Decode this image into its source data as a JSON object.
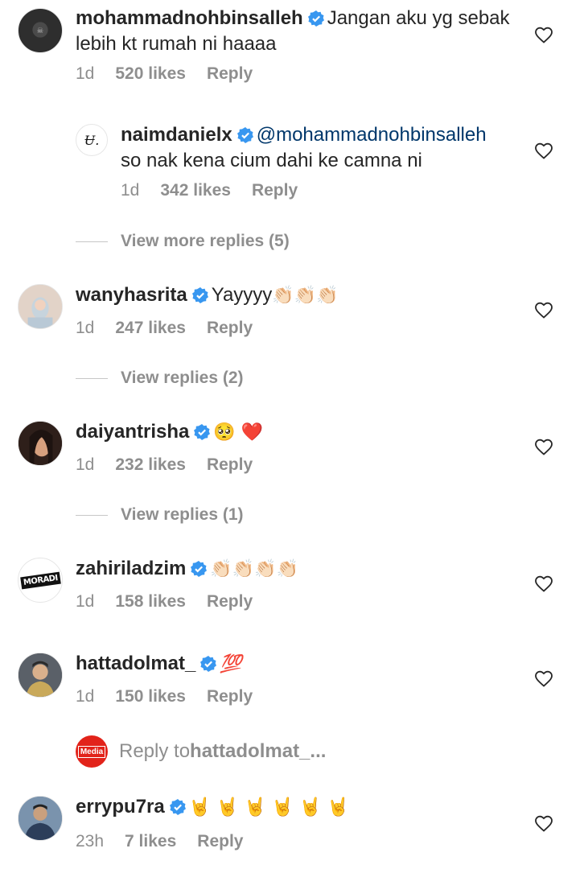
{
  "comments": [
    {
      "username": "mohammadnohbinsalleh",
      "text": "Jangan aku yg sebak lebih kt rumah ni haaaa",
      "time": "1d",
      "likes": "520 likes",
      "reply": "Reply"
    },
    {
      "username": "naimdanielx",
      "mention": "@mohammadnohbinsalleh",
      "text": "so nak kena cium dahi ke camna ni",
      "time": "1d",
      "likes": "342 likes",
      "reply": "Reply"
    },
    {
      "username": "wanyhasrita",
      "text": "Yayyyy",
      "emoji": "👏🏻👏🏻👏🏻",
      "time": "1d",
      "likes": "247 likes",
      "reply": "Reply"
    },
    {
      "username": "daiyantrisha",
      "emoji": "🥺 ❤️",
      "time": "1d",
      "likes": "232 likes",
      "reply": "Reply"
    },
    {
      "username": "zahiriladzim",
      "emoji": "👏🏻👏🏻👏🏻👏🏻",
      "time": "1d",
      "likes": "158 likes",
      "reply": "Reply"
    },
    {
      "username": "hattadolmat_",
      "emoji": "💯",
      "time": "1d",
      "likes": "150 likes",
      "reply": "Reply"
    },
    {
      "username": "errypu7ra",
      "emoji": "🤘 🤘 🤘 🤘 🤘 🤘",
      "time": "23h",
      "likes": "7 likes",
      "reply": "Reply"
    }
  ],
  "view_more": [
    {
      "label": "View more replies (5)"
    },
    {
      "label": "View replies (2)"
    },
    {
      "label": "View replies (1)"
    }
  ],
  "reply_to": {
    "prefix": "Reply to ",
    "target": "hattadolmat_..."
  },
  "avatars": {
    "naimdanielx_logo": "Ʉ.",
    "zahiriladzim_logo": "MORADI",
    "media_logo": "Media"
  },
  "colors": {
    "verified": "#3897f0",
    "meta": "#8e8e8e",
    "mention": "#00376b"
  },
  "icons": {
    "like": "heart-outline-icon",
    "verified": "verified-badge-icon"
  }
}
